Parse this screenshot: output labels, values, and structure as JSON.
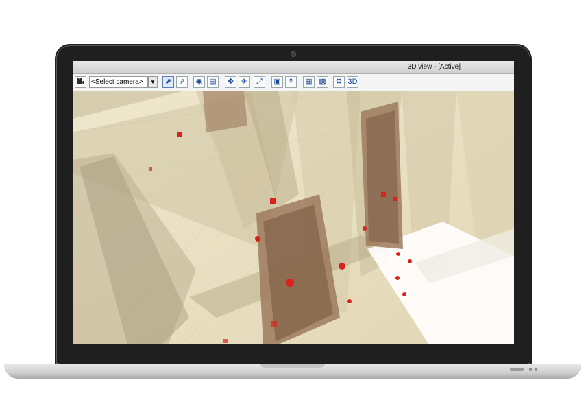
{
  "window": {
    "title": "3D view - [Active]"
  },
  "toolbar": {
    "camera_select_value": "<Select camera>",
    "buttons": [
      {
        "name": "camera-manager-icon"
      },
      {
        "name": "orbit-camera-icon"
      },
      {
        "name": "pan-camera-icon"
      },
      {
        "name": "render-style-icon"
      },
      {
        "name": "wall-display-icon"
      },
      {
        "name": "walk-mode-icon"
      },
      {
        "name": "fly-mode-icon"
      },
      {
        "name": "path-mode-icon"
      },
      {
        "name": "cut-plane-icon"
      },
      {
        "name": "elevation-icon"
      },
      {
        "name": "section-icon"
      },
      {
        "name": "texture-icon"
      },
      {
        "name": "snapshot-icon"
      },
      {
        "name": "view-3d-icon"
      }
    ]
  },
  "colors": {
    "bezel": "#1f1f1f",
    "floor": "#e8dfbf",
    "marker": "#d8231d"
  }
}
